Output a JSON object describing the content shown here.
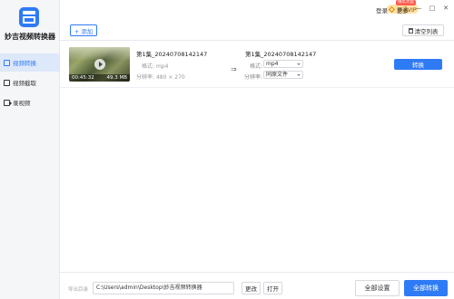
{
  "app": {
    "name": "妙吉视频转换器"
  },
  "sidebar": {
    "items": [
      {
        "label": "视频转换",
        "icon": "video-convert-icon",
        "active": true
      },
      {
        "label": "视频截取",
        "icon": "video-cut-icon",
        "active": false
      },
      {
        "label": "录视频",
        "icon": "record-icon",
        "active": false
      }
    ]
  },
  "header": {
    "vip_label": "开通VIP",
    "promo_badge": "限年大促",
    "login": "登录",
    "more": "更多",
    "minimize": "—",
    "maximize": "□",
    "close": "✕"
  },
  "toolbar": {
    "add_label": "+ 添加",
    "clear_label": "清空列表"
  },
  "file": {
    "duration": "00:45:32",
    "size": "49.3 MB",
    "source": {
      "name": "第1集_20240708142147",
      "format_label": "格式:",
      "format": "mp4",
      "resolution_label": "分辨率:",
      "resolution": "480 × 270"
    },
    "arrow": "⇒",
    "target": {
      "name": "第1集_20240708142147",
      "format_label": "格式:",
      "format": "mp4",
      "resolution_label": "分辨率:",
      "resolution": "同原文件"
    },
    "convert_label": "转换"
  },
  "footer": {
    "output_label": "导出目录",
    "output_path": "C:\\Users\\admin\\Desktop\\妙吉视频转换器",
    "change_label": "更改",
    "open_label": "打开",
    "settings_label": "全部设置",
    "convert_all_label": "全部转换"
  },
  "colors": {
    "accent": "#2f7bf5",
    "sidebar_bg": "#f5f6f8",
    "active_bg": "#dde8fb"
  }
}
